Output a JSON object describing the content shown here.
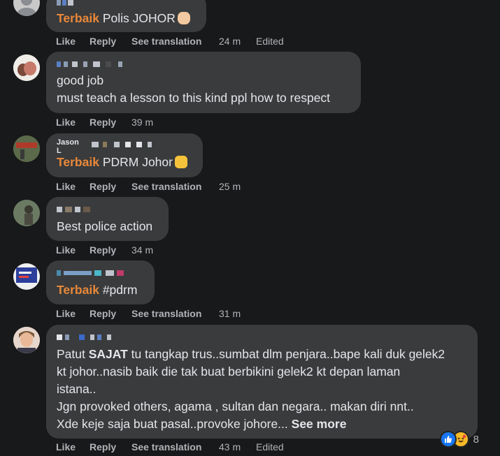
{
  "comments": [
    {
      "prefix": "Terbaik",
      "text": " Polis JOHOR",
      "actions": [
        "Like",
        "Reply",
        "See translation"
      ],
      "time": "24 m",
      "edited": "Edited"
    },
    {
      "lines": [
        "good job",
        "must teach a lesson to this kind ppl how to respect"
      ],
      "actions": [
        "Like",
        "Reply"
      ],
      "time": "39 m"
    },
    {
      "name": "Jason L",
      "prefix": "Terbaik",
      "text": " PDRM Johor",
      "actions": [
        "Like",
        "Reply",
        "See translation"
      ],
      "time": "25 m"
    },
    {
      "lines": [
        "Best police action"
      ],
      "actions": [
        "Like",
        "Reply"
      ],
      "time": "34 m"
    },
    {
      "prefix": "Terbaik",
      "text": " #pdrm",
      "actions": [
        "Like",
        "Reply",
        "See translation"
      ],
      "time": "31 m"
    },
    {
      "line1_a": "Patut ",
      "line1_bold": "SAJAT",
      "line1_b": " tu tangkap trus..sumbat dlm penjara..bape kali duk gelek2",
      "line2": "kt johor..nasib baik die tak buat berbikini gelek2 kt depan laman",
      "line3": "istana..",
      "line4": "Jgn provoked others, agama , sultan dan negara.. makan diri nnt..",
      "line5": "Xde keje saja buat pasal..provoke johore...",
      "see_more": "See more",
      "actions": [
        "Like",
        "Reply",
        "See translation"
      ],
      "time": "43 m",
      "edited": "Edited",
      "reactions": {
        "icons": [
          "like-icon",
          "haha-icon"
        ],
        "count": "8"
      }
    }
  ],
  "colors": {
    "background": "#18191a",
    "bubble": "#3a3b3c",
    "highlight": "#e8883a",
    "meta": "#b0b3b8"
  }
}
